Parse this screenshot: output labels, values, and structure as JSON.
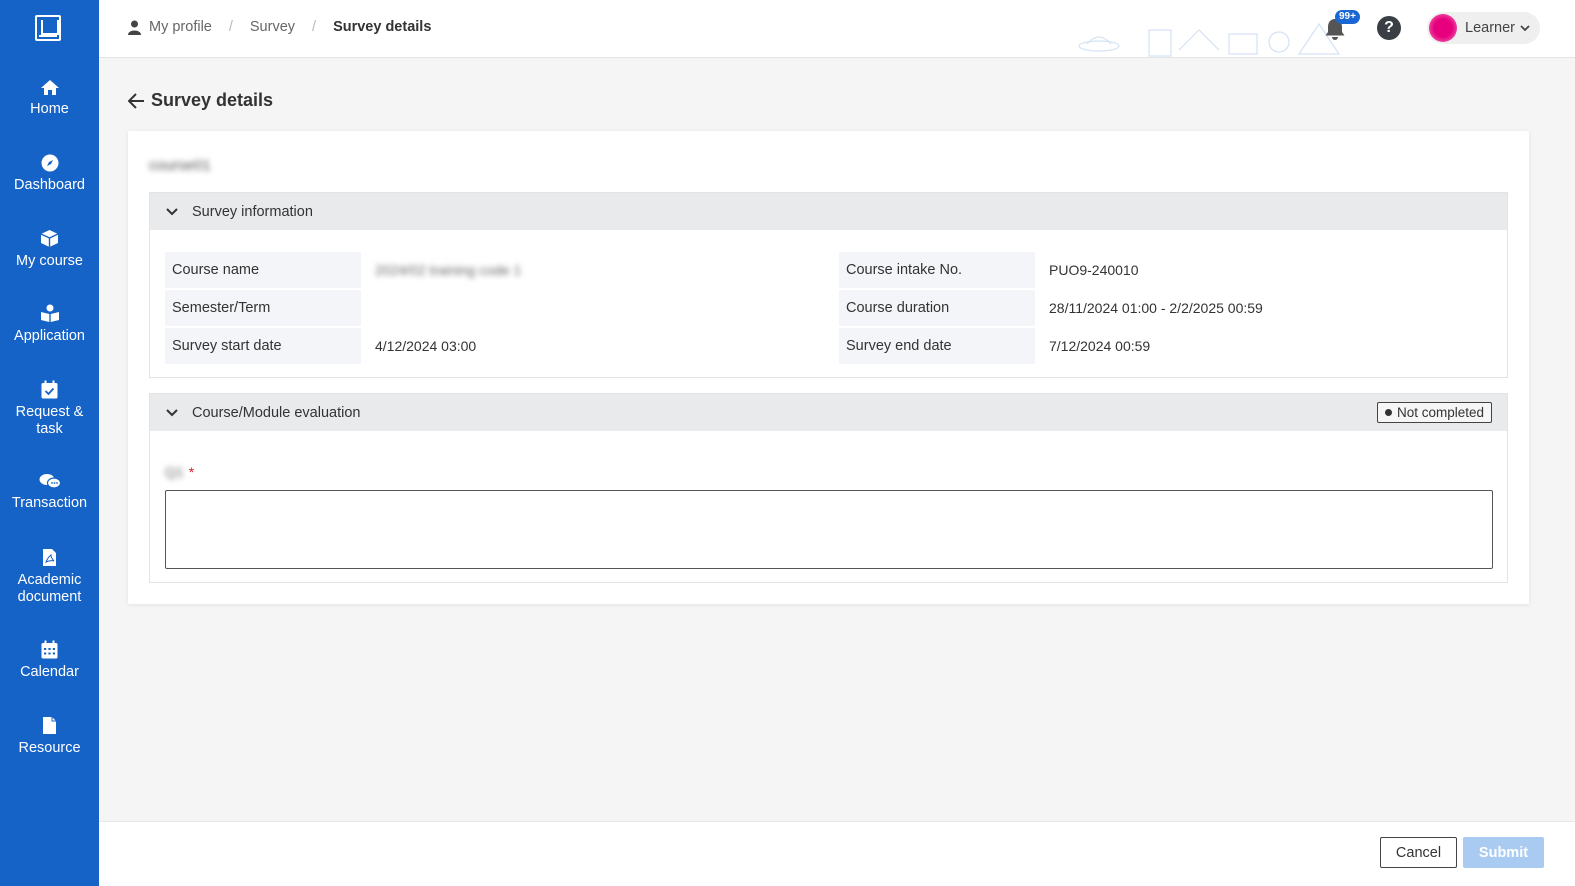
{
  "sidebar": {
    "items": [
      {
        "label": "Home",
        "icon": "home-icon"
      },
      {
        "label": "Dashboard",
        "icon": "compass-icon"
      },
      {
        "label": "My course",
        "icon": "cube-icon"
      },
      {
        "label": "Application",
        "icon": "book-reader-icon"
      },
      {
        "label": "Request &",
        "label2": "task",
        "icon": "calendar-check-icon"
      },
      {
        "label": "Transaction",
        "icon": "chat-icon"
      },
      {
        "label": "Academic",
        "label2": "document",
        "icon": "pdf-file-icon"
      },
      {
        "label": "Calendar",
        "icon": "calendar-icon"
      },
      {
        "label": "Resource",
        "icon": "file-icon"
      }
    ]
  },
  "header": {
    "breadcrumb": [
      "My profile",
      "Survey",
      "Survey details"
    ],
    "notifications_badge": "99+",
    "help": "?",
    "user_name": "Learner"
  },
  "page": {
    "title": "Survey details",
    "course_code": "course01"
  },
  "survey_info": {
    "heading": "Survey information",
    "rows": [
      {
        "label": "Course name",
        "value": "2024/02 training code 1"
      },
      {
        "label": "Semester/Term",
        "value": ""
      },
      {
        "label": "Survey start date",
        "value": "4/12/2024 03:00"
      },
      {
        "label": "Course intake No.",
        "value": "PUO9-240010"
      },
      {
        "label": "Course duration",
        "value": "28/11/2024 01:00 - 2/2/2025 00:59"
      },
      {
        "label": "Survey end date",
        "value": "7/12/2024 00:59"
      }
    ]
  },
  "evaluation": {
    "heading": "Course/Module evaluation",
    "status": "Not completed",
    "question_label": "Q1",
    "required_mark": "*",
    "answer": ""
  },
  "footer": {
    "cancel_label": "Cancel",
    "submit_label": "Submit"
  },
  "colors": {
    "sidebar": "#1563c7",
    "submit_disabled": "#a9cbf2",
    "required": "#e02020"
  }
}
